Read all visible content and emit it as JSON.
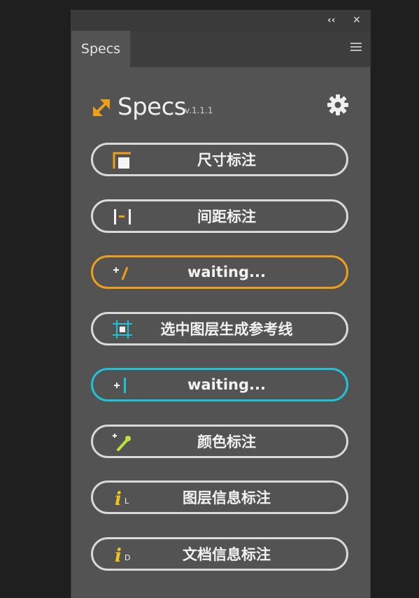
{
  "panel": {
    "collapse_glyph": "‹‹",
    "close_glyph": "✕",
    "tab_label": "Specs",
    "menu_icon": "hamburger-menu-icon"
  },
  "header": {
    "title": "Specs",
    "version": "v.1.1.1",
    "logo_icon": "diagonal-arrows-icon",
    "settings_icon": "gear-icon"
  },
  "buttons": [
    {
      "label": "尺寸标注",
      "icon": "size-annotation-icon",
      "border": "#d9d9d9"
    },
    {
      "label": "间距标注",
      "icon": "spacing-annotation-icon",
      "border": "#d9d9d9"
    },
    {
      "label": "waiting...",
      "icon": "plus-slash-icon",
      "border": "#f0a018"
    },
    {
      "label": "选中图层生成参考线",
      "icon": "guide-frame-icon",
      "border": "#d9d9d9"
    },
    {
      "label": "waiting...",
      "icon": "plus-bar-icon",
      "border": "#1fc3d8"
    },
    {
      "label": "颜色标注",
      "icon": "eyedropper-icon",
      "border": "#d9d9d9"
    },
    {
      "label": "图层信息标注",
      "icon": "info-layer-icon",
      "icon_letter": "L",
      "border": "#d9d9d9"
    },
    {
      "label": "文档信息标注",
      "icon": "info-document-icon",
      "icon_letter": "D",
      "border": "#d9d9d9"
    }
  ],
  "colors": {
    "accent_orange": "#f0a018",
    "accent_cyan": "#1fc3d8",
    "accent_green": "#b6e43a",
    "panel_bg": "#535353"
  }
}
